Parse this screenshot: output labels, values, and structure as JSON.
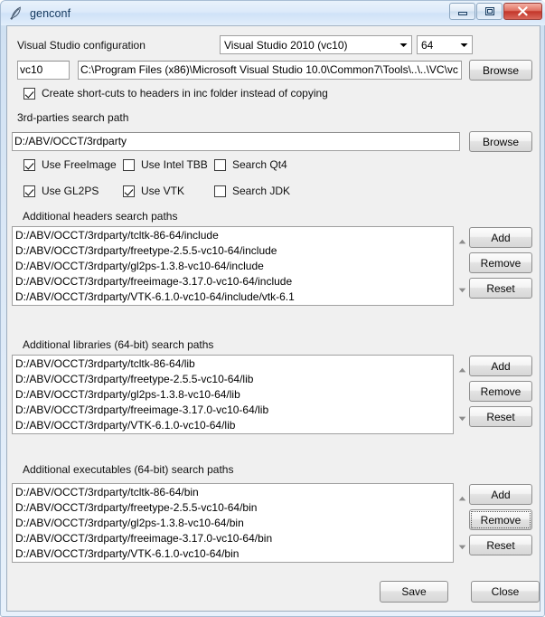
{
  "window": {
    "title": "genconf",
    "icon": "feather-quill-icon",
    "controls": {
      "minimize": "minimize-icon",
      "maximize": "maximize-icon",
      "close": "close-icon"
    },
    "colors": {
      "titlebar_gradient_top": "#e9f2fb",
      "titlebar_gradient_bottom": "#e2eefb",
      "frame_border": "#a8bdd4",
      "client_bg": "#f0f0f0",
      "close_button": "#c3362a",
      "text": "#111111",
      "entry_bg": "#ffffff"
    }
  },
  "vs_section": {
    "label": "Visual Studio configuration",
    "version_combo": {
      "value": "Visual Studio 2010 (vc10)",
      "arrow": "chevron-down-icon"
    },
    "bitness_combo": {
      "value": "64",
      "arrow": "chevron-down-icon"
    },
    "short_name_value": "vc10",
    "vs_path_value": "C:\\Program Files (x86)\\Microsoft Visual Studio 10.0\\Common7\\Tools\\..\\..\\VC\\vc",
    "browse_label": "Browse",
    "shortcuts_checkbox": {
      "label": "Create short-cuts to headers in inc folder instead of copying",
      "checked": true
    }
  },
  "thirdparty_section": {
    "label": "3rd-parties search path",
    "path_value": "D:/ABV/OCCT/3rdparty",
    "browse_label": "Browse",
    "checkboxes": [
      {
        "label": "Use FreeImage",
        "checked": true
      },
      {
        "label": "Use Intel TBB",
        "checked": false
      },
      {
        "label": "Search Qt4",
        "checked": false
      },
      {
        "label": "Use GL2PS",
        "checked": true
      },
      {
        "label": "Use VTK",
        "checked": true
      },
      {
        "label": "Search JDK",
        "checked": false
      }
    ]
  },
  "headers_section": {
    "label": "Additional headers search paths",
    "items": [
      "D:/ABV/OCCT/3rdparty/tcltk-86-64/include",
      "D:/ABV/OCCT/3rdparty/freetype-2.5.5-vc10-64/include",
      "D:/ABV/OCCT/3rdparty/gl2ps-1.3.8-vc10-64/include",
      "D:/ABV/OCCT/3rdparty/freeimage-3.17.0-vc10-64/include",
      "D:/ABV/OCCT/3rdparty/VTK-6.1.0-vc10-64/include/vtk-6.1"
    ],
    "buttons": {
      "add": "Add",
      "remove": "Remove",
      "reset": "Reset"
    },
    "scroll_up_icon": "scroll-up-arrow-icon",
    "scroll_down_icon": "scroll-down-arrow-icon"
  },
  "libraries_section": {
    "label": "Additional libraries (64-bit) search paths",
    "items": [
      "D:/ABV/OCCT/3rdparty/tcltk-86-64/lib",
      "D:/ABV/OCCT/3rdparty/freetype-2.5.5-vc10-64/lib",
      "D:/ABV/OCCT/3rdparty/gl2ps-1.3.8-vc10-64/lib",
      "D:/ABV/OCCT/3rdparty/freeimage-3.17.0-vc10-64/lib",
      "D:/ABV/OCCT/3rdparty/VTK-6.1.0-vc10-64/lib"
    ],
    "buttons": {
      "add": "Add",
      "remove": "Remove",
      "reset": "Reset"
    },
    "scroll_up_icon": "scroll-up-arrow-icon",
    "scroll_down_icon": "scroll-down-arrow-icon"
  },
  "executables_section": {
    "label": "Additional executables (64-bit) search paths",
    "items": [
      "D:/ABV/OCCT/3rdparty/tcltk-86-64/bin",
      "D:/ABV/OCCT/3rdparty/freetype-2.5.5-vc10-64/bin",
      "D:/ABV/OCCT/3rdparty/gl2ps-1.3.8-vc10-64/bin",
      "D:/ABV/OCCT/3rdparty/freeimage-3.17.0-vc10-64/bin",
      "D:/ABV/OCCT/3rdparty/VTK-6.1.0-vc10-64/bin"
    ],
    "buttons": {
      "add": "Add",
      "remove": "Remove",
      "reset": "Reset"
    },
    "remove_focused": true,
    "scroll_up_icon": "scroll-up-arrow-icon",
    "scroll_down_icon": "scroll-down-arrow-icon"
  },
  "footer": {
    "save_label": "Save",
    "close_label": "Close"
  }
}
